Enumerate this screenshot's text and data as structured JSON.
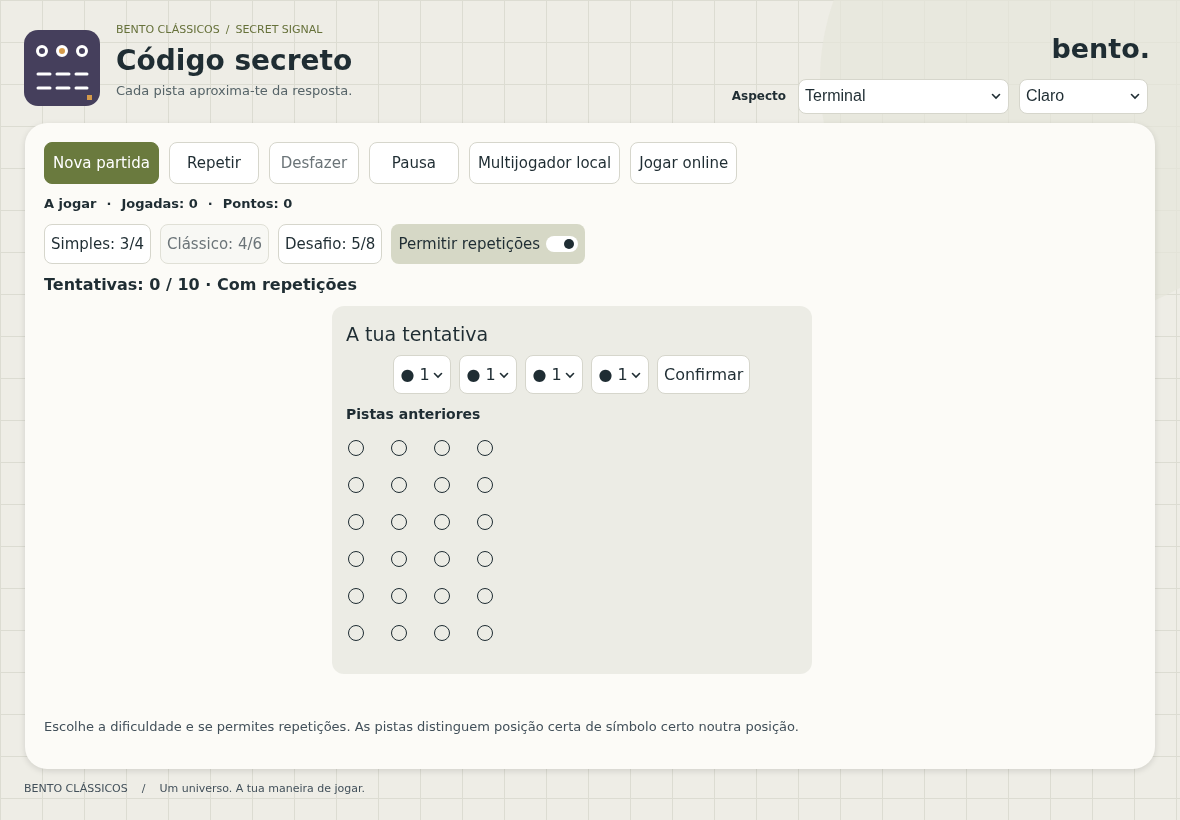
{
  "header": {
    "breadcrumb": [
      "BENTO CLÁSSICOS",
      "/",
      "SECRET SIGNAL"
    ],
    "title": "Código secreto",
    "subtitle": "Cada pista aproxima-te da resposta.",
    "brand": "bento.",
    "appearance_label": "Aspecto",
    "theme_select": "Terminal",
    "mode_select": "Claro"
  },
  "actions": [
    {
      "label": "Nova partida",
      "kind": "primary",
      "disabled": false
    },
    {
      "label": "Repetir",
      "kind": "normal",
      "disabled": false
    },
    {
      "label": "Desfazer",
      "kind": "normal",
      "disabled": true
    },
    {
      "label": "Pausa",
      "kind": "normal",
      "disabled": false
    },
    {
      "label": "Multijogador local",
      "kind": "normal",
      "disabled": false
    },
    {
      "label": "Jogar online",
      "kind": "normal",
      "disabled": false
    }
  ],
  "status": [
    "A jogar",
    "·",
    "Jogadas: 0",
    "·",
    "Pontos: 0"
  ],
  "difficulties": [
    {
      "label": "Simples: 3/4",
      "selected": false
    },
    {
      "label": "Clássico: 4/6",
      "selected": true
    },
    {
      "label": "Desafio: 5/8",
      "selected": false
    }
  ],
  "repeat_toggle": {
    "label": "Permitir repetições",
    "on": true
  },
  "attempts": "Tentativas: 0 / 10 · Com repetições",
  "guess_panel": {
    "title": "A tua tentativa",
    "slots": [
      "● 1",
      "● 1",
      "● 1",
      "● 1"
    ],
    "confirm": "Confirmar",
    "history_label": "Pistas anteriores",
    "clue_rows": [
      {
        "pegs": [
          {
            "filled": false
          },
          {
            "filled": false
          },
          {
            "filled": false
          },
          {
            "filled": false
          }
        ]
      },
      {
        "pegs": [
          {
            "filled": false
          },
          {
            "filled": false
          },
          {
            "filled": false
          },
          {
            "filled": false
          }
        ]
      },
      {
        "pegs": [
          {
            "filled": false
          },
          {
            "filled": false
          },
          {
            "filled": false
          },
          {
            "filled": false
          }
        ]
      },
      {
        "pegs": [
          {
            "filled": false
          },
          {
            "filled": false
          },
          {
            "filled": false
          },
          {
            "filled": false
          }
        ]
      },
      {
        "pegs": [
          {
            "filled": false
          },
          {
            "filled": false
          },
          {
            "filled": false
          },
          {
            "filled": false
          }
        ]
      },
      {
        "pegs": [
          {
            "filled": false
          },
          {
            "filled": false
          },
          {
            "filled": false
          },
          {
            "filled": false
          }
        ]
      }
    ]
  },
  "help_text": "Escolhe a dificuldade e se permites repetições. As pistas distinguem posição certa de símbolo certo noutra posição.",
  "footer": [
    "BENTO CLÁSSICOS",
    "/",
    "Um universo. A tua maneira de jogar."
  ]
}
